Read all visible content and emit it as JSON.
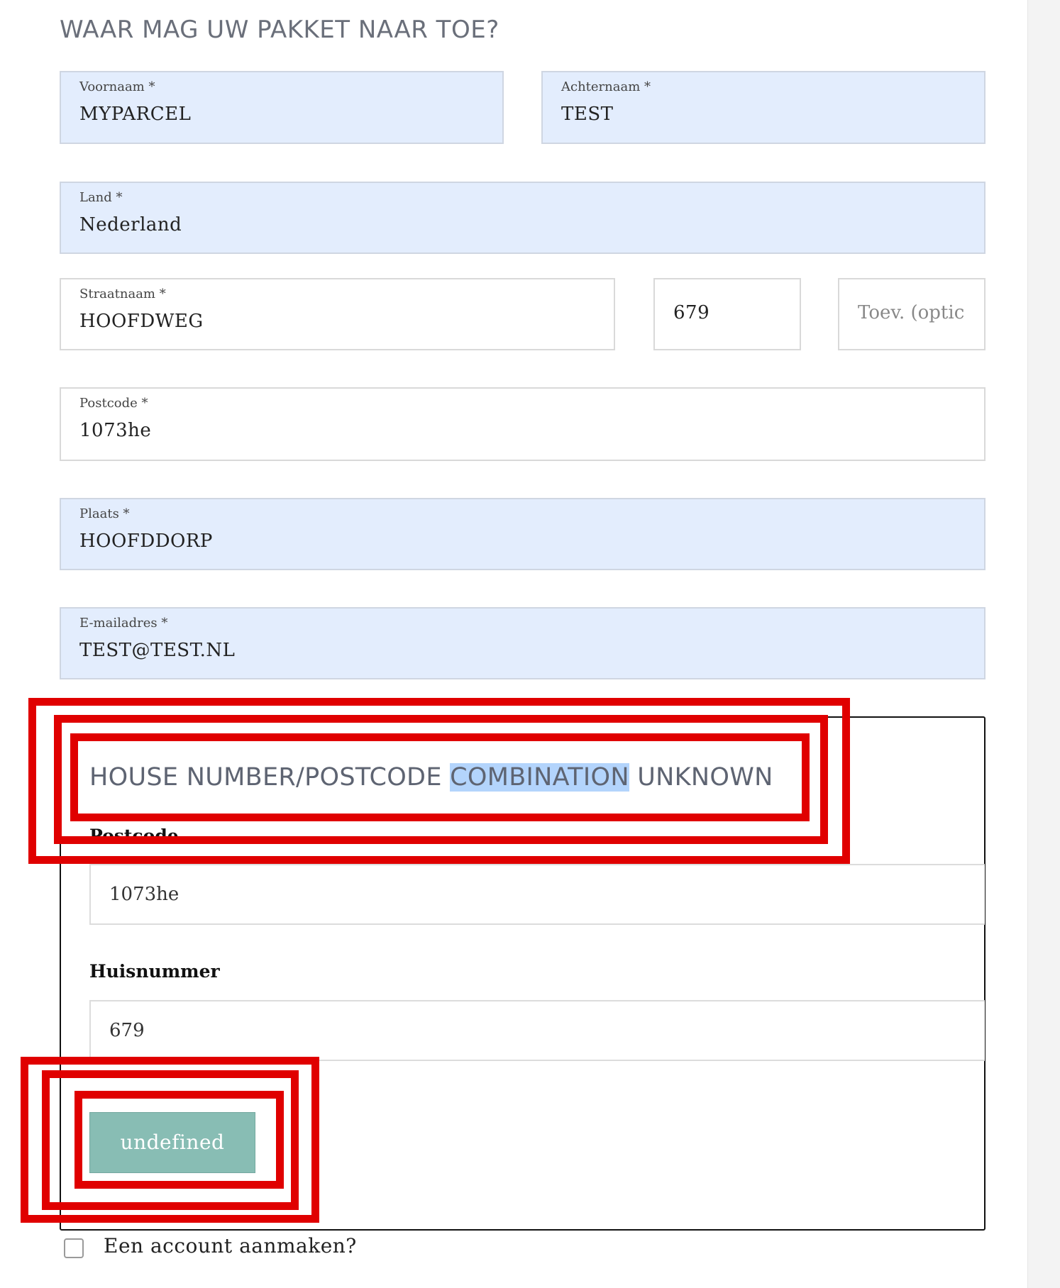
{
  "heading": "WAAR MAG UW PAKKET NAAR TOE?",
  "form": {
    "first_name": {
      "label": "Voornaam *",
      "value": "MYPARCEL"
    },
    "last_name": {
      "label": "Achternaam *",
      "value": "TEST"
    },
    "country": {
      "label": "Land *",
      "value": "Nederland"
    },
    "street": {
      "label": "Straatnaam *",
      "value": "HOOFDWEG"
    },
    "house_number": {
      "value": "679"
    },
    "addition": {
      "placeholder": "Toev. (optic"
    },
    "postcode": {
      "label": "Postcode *",
      "value": "1073he"
    },
    "city": {
      "label": "Plaats *",
      "value": "HOOFDDORP"
    },
    "email": {
      "label": "E-mailadres *",
      "value": "TEST@TEST.NL"
    }
  },
  "modal": {
    "title_before": "HOUSE NUMBER/POSTCODE ",
    "title_highlight": "COMBINATION",
    "title_after": " UNKNOWN",
    "postcode_label": "Postcode",
    "postcode_value": "1073he",
    "house_number_label": "Huisnummer",
    "house_number_value": "679",
    "button_label": "undefined"
  },
  "create_account_label": "Een account aanmaken?",
  "colors": {
    "autofill_bg": "#e3edfd",
    "button_bg": "#88bdb4",
    "annotation_red": "#e00000",
    "selection_highlight": "#b3d4fc"
  }
}
